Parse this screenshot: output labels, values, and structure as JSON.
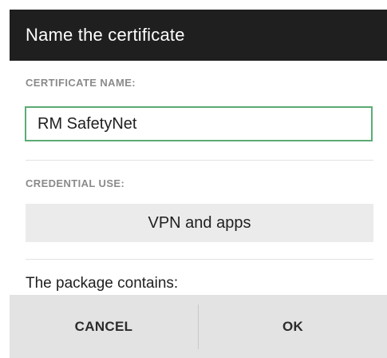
{
  "dialog": {
    "title": "Name the certificate",
    "certificate_name_label": "CERTIFICATE NAME:",
    "certificate_name_value": "RM SafetyNet",
    "credential_use_label": "CREDENTIAL USE:",
    "credential_use_value": "VPN and apps",
    "package_text": "The package contains:",
    "cancel_label": "CANCEL",
    "ok_label": "OK"
  },
  "colors": {
    "title_bar": "#1f1f1f",
    "input_border_focus": "#5bab74",
    "button_bar": "#e3e3e3",
    "select_background": "#ebebeb"
  }
}
